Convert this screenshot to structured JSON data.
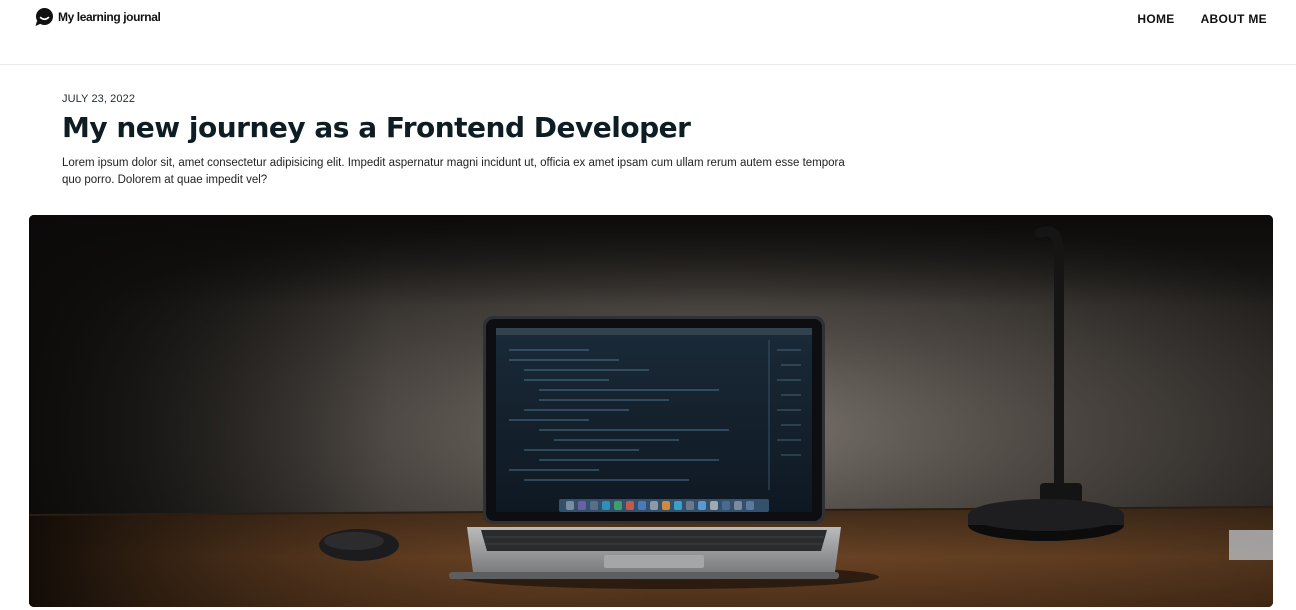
{
  "header": {
    "logo_text": "My learning journal",
    "logo_icon": "chat-bubble-icon",
    "nav": [
      {
        "label": "HOME"
      },
      {
        "label": "ABOUT ME"
      }
    ]
  },
  "post": {
    "date": "JULY 23, 2022",
    "title": "My new journey as a Frontend Developer",
    "excerpt": "Lorem ipsum dolor sit, amet consectetur adipisicing elit. Impedit aspernatur magni incidunt ut, officia ex amet ipsam cum ullam rerum autem esse tempora quo porro. Dolorem at quae impedit vel?",
    "hero_image": "laptop-on-desk-photo"
  },
  "colors": {
    "text": "#0e1c24",
    "border": "#e9e9e9",
    "background": "#ffffff"
  }
}
